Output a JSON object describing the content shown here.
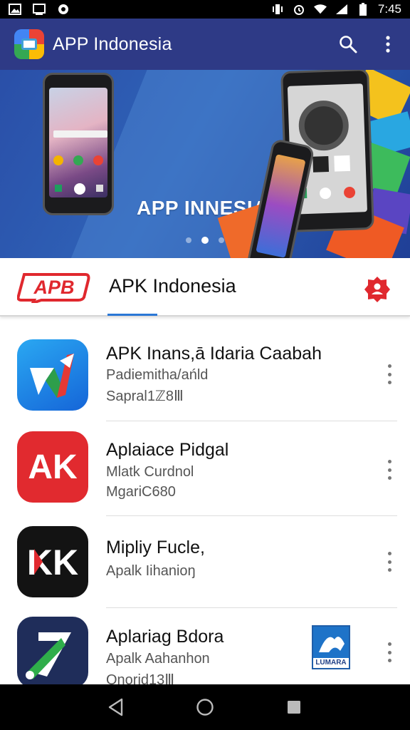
{
  "status_bar": {
    "time": "7:45",
    "left_icons": [
      "image-icon",
      "screen-icon",
      "ring-icon"
    ],
    "right_icons": [
      "vibrate-icon",
      "alarm-icon",
      "wifi-icon",
      "signal-icon",
      "battery-icon"
    ]
  },
  "app_bar": {
    "title": "APP Indonesia",
    "icons": [
      "app-logo-icon",
      "search-icon",
      "more-vert-icon"
    ]
  },
  "banner": {
    "text": "APP INNESIA",
    "page_count": 3,
    "active_page": 2
  },
  "tab_strip": {
    "logo_text": "APB",
    "title": "APK Indonesia",
    "badge_icon": "badge-icon"
  },
  "apps": [
    {
      "title": "APK Inans,ā Idaria Caabah",
      "subtitle": "Padiemitha/ańld",
      "meta": "Sapral1ℤ8Ⅲ",
      "icon": "blue-arrow-app-icon"
    },
    {
      "title": "Aplaiace Pidgal",
      "subtitle": "Mlatk Curdnol",
      "meta": "MgariC680",
      "icon": "red-ak-app-icon"
    },
    {
      "title": "Mipliy Fucle,",
      "subtitle": "Apalk Iihanioŋ",
      "meta": "",
      "icon": "black-kk-app-icon"
    },
    {
      "title": "Aplariag Bdora",
      "subtitle": "Apalk Aahanhon",
      "meta": "Onorid13Ⅲ",
      "icon": "navy-green-slash-app-icon",
      "badge_text": "LUMARA"
    }
  ],
  "nav_bar": {
    "icons": [
      "back-icon",
      "home-icon",
      "recents-icon"
    ]
  },
  "colors": {
    "app_bar": "#2e3a86",
    "banner": "#2f63b8",
    "tab_indicator": "#2b78d6",
    "accent_red": "#e0282e"
  }
}
